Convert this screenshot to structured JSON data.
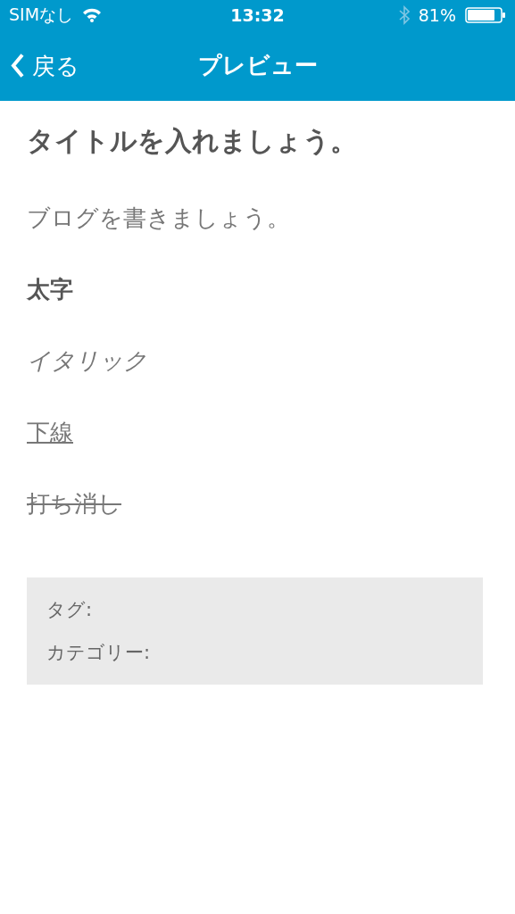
{
  "status_bar": {
    "carrier": "SIMなし",
    "time": "13:32",
    "battery": "81%"
  },
  "nav_bar": {
    "back": "戻る",
    "title": "プレビュー"
  },
  "content": [
    {
      "kind": "title",
      "text": "タイトルを入れましょう。"
    },
    {
      "kind": "paragraph",
      "text": "ブログを書きましょう。"
    },
    {
      "kind": "bold",
      "text": "太字"
    },
    {
      "kind": "italic",
      "text": "イタリック"
    },
    {
      "kind": "underline",
      "text": "下線"
    },
    {
      "kind": "strike",
      "text": "打ち消し"
    }
  ],
  "meta": [
    {
      "label": "タグ:"
    },
    {
      "label": "カテゴリー:"
    }
  ]
}
